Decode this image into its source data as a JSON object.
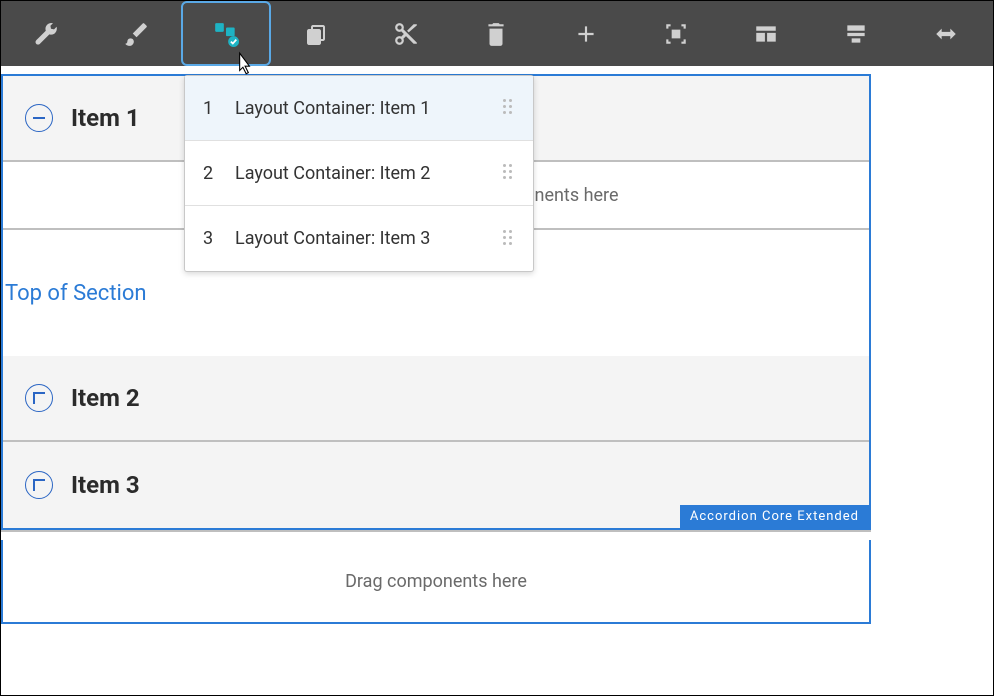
{
  "toolbar": {
    "icons": [
      {
        "name": "wrench-icon"
      },
      {
        "name": "brush-icon"
      },
      {
        "name": "panel-select-icon",
        "active": true
      },
      {
        "name": "copy-icon"
      },
      {
        "name": "cut-icon"
      },
      {
        "name": "delete-icon"
      },
      {
        "name": "insert-icon"
      },
      {
        "name": "group-icon"
      },
      {
        "name": "layout-icon"
      },
      {
        "name": "structure-icon"
      },
      {
        "name": "convert-icon"
      }
    ]
  },
  "dropdown": {
    "items": [
      {
        "index": "1",
        "label": "Layout Container: Item 1",
        "highlighted": true
      },
      {
        "index": "2",
        "label": "Layout Container: Item 2",
        "highlighted": false
      },
      {
        "index": "3",
        "label": "Layout Container: Item 3",
        "highlighted": false
      }
    ]
  },
  "accordion": {
    "items": [
      {
        "title": "Item 1",
        "expanded": true
      },
      {
        "title": "Item 2",
        "expanded": false
      },
      {
        "title": "Item 3",
        "expanded": false
      }
    ],
    "inner_drop_text": "Please drag Accordion Item components here",
    "section_link": "Top of Section",
    "component_badge": "Accordion Core Extended"
  },
  "parsys": {
    "drop_text": "Drag components here"
  }
}
